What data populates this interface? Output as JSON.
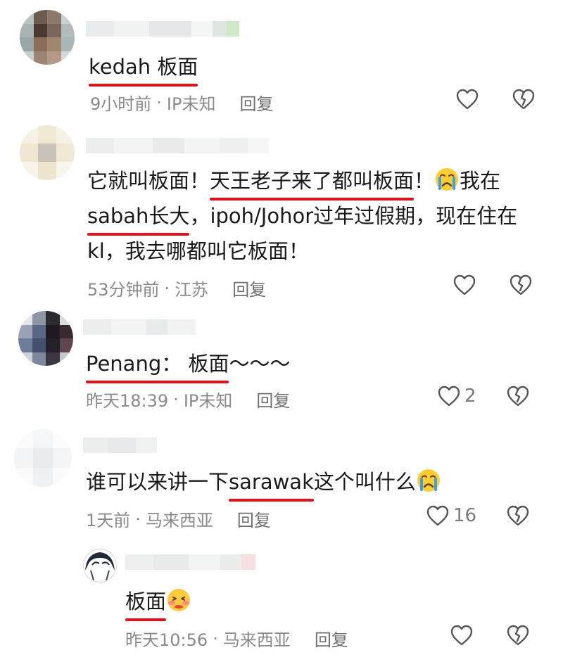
{
  "comments": [
    {
      "text_parts": [
        {
          "t": "kedah 板面",
          "u": true
        }
      ],
      "time": "9小时前",
      "location": "IP未知",
      "reply_label": "回复",
      "likes": ""
    },
    {
      "text_lines": [
        [
          {
            "t": "它就叫板面！",
            "u": false
          },
          {
            "t": "天王老子来了都叫板面",
            "u": true
          },
          {
            "t": "！",
            "u": false
          },
          {
            "emoji": "crying-face-emoji"
          },
          {
            "t": "我在",
            "u": false
          }
        ],
        [
          {
            "t": "sabah长大",
            "u": true
          },
          {
            "t": "，ipoh/Johor过年过假期，现在住在",
            "u": false
          }
        ],
        [
          {
            "t": "kl，我去哪都叫它板面！",
            "u": false
          }
        ]
      ],
      "time": "53分钟前",
      "location": "江苏",
      "reply_label": "回复",
      "likes": ""
    },
    {
      "text_parts": [
        {
          "t": "Penang：  板面",
          "u": true
        },
        {
          "t": "～～～",
          "u": false
        }
      ],
      "time": "昨天18:39",
      "location": "IP未知",
      "reply_label": "回复",
      "likes": "2"
    },
    {
      "text_parts": [
        {
          "t": "谁可以来讲一下",
          "u": false
        },
        {
          "t": "sarawak",
          "u": true
        },
        {
          "t": "这个叫什么",
          "u": false
        }
      ],
      "time": "1天前",
      "location": "马来西亚",
      "reply_label": "回复",
      "likes": "16"
    },
    {
      "text_parts": [
        {
          "t": "板面",
          "u": true
        }
      ],
      "time": "昨天10:56",
      "location": "马来西亚",
      "reply_label": "回复",
      "likes": ""
    }
  ],
  "separator": "·",
  "colors": {
    "underline": "#e3101a",
    "meta": "#8a8a8a",
    "icon": "#555555"
  }
}
